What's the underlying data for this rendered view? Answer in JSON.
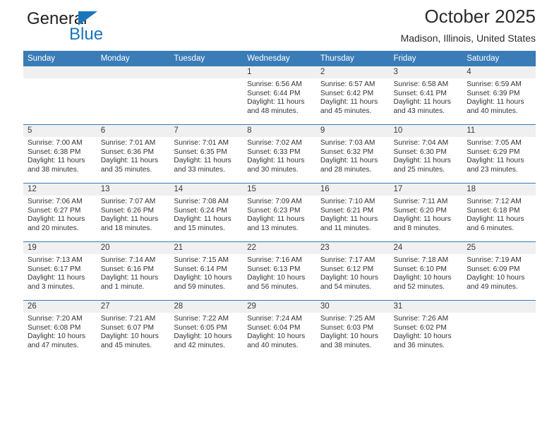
{
  "brand": {
    "name_top": "General",
    "name_bottom": "Blue",
    "logo_icon": "triangle-icon",
    "accent_color": "#1b75bb"
  },
  "header": {
    "title": "October 2025",
    "subtitle": "Madison, Illinois, United States"
  },
  "calendar": {
    "header_color": "#3a7cb8",
    "weekday_headers": [
      "Sunday",
      "Monday",
      "Tuesday",
      "Wednesday",
      "Thursday",
      "Friday",
      "Saturday"
    ],
    "weeks": [
      [
        {
          "day": "",
          "lines": []
        },
        {
          "day": "",
          "lines": []
        },
        {
          "day": "",
          "lines": []
        },
        {
          "day": "1",
          "lines": [
            "Sunrise: 6:56 AM",
            "Sunset: 6:44 PM",
            "Daylight: 11 hours",
            "and 48 minutes."
          ]
        },
        {
          "day": "2",
          "lines": [
            "Sunrise: 6:57 AM",
            "Sunset: 6:42 PM",
            "Daylight: 11 hours",
            "and 45 minutes."
          ]
        },
        {
          "day": "3",
          "lines": [
            "Sunrise: 6:58 AM",
            "Sunset: 6:41 PM",
            "Daylight: 11 hours",
            "and 43 minutes."
          ]
        },
        {
          "day": "4",
          "lines": [
            "Sunrise: 6:59 AM",
            "Sunset: 6:39 PM",
            "Daylight: 11 hours",
            "and 40 minutes."
          ]
        }
      ],
      [
        {
          "day": "5",
          "lines": [
            "Sunrise: 7:00 AM",
            "Sunset: 6:38 PM",
            "Daylight: 11 hours",
            "and 38 minutes."
          ]
        },
        {
          "day": "6",
          "lines": [
            "Sunrise: 7:01 AM",
            "Sunset: 6:36 PM",
            "Daylight: 11 hours",
            "and 35 minutes."
          ]
        },
        {
          "day": "7",
          "lines": [
            "Sunrise: 7:01 AM",
            "Sunset: 6:35 PM",
            "Daylight: 11 hours",
            "and 33 minutes."
          ]
        },
        {
          "day": "8",
          "lines": [
            "Sunrise: 7:02 AM",
            "Sunset: 6:33 PM",
            "Daylight: 11 hours",
            "and 30 minutes."
          ]
        },
        {
          "day": "9",
          "lines": [
            "Sunrise: 7:03 AM",
            "Sunset: 6:32 PM",
            "Daylight: 11 hours",
            "and 28 minutes."
          ]
        },
        {
          "day": "10",
          "lines": [
            "Sunrise: 7:04 AM",
            "Sunset: 6:30 PM",
            "Daylight: 11 hours",
            "and 25 minutes."
          ]
        },
        {
          "day": "11",
          "lines": [
            "Sunrise: 7:05 AM",
            "Sunset: 6:29 PM",
            "Daylight: 11 hours",
            "and 23 minutes."
          ]
        }
      ],
      [
        {
          "day": "12",
          "lines": [
            "Sunrise: 7:06 AM",
            "Sunset: 6:27 PM",
            "Daylight: 11 hours",
            "and 20 minutes."
          ]
        },
        {
          "day": "13",
          "lines": [
            "Sunrise: 7:07 AM",
            "Sunset: 6:26 PM",
            "Daylight: 11 hours",
            "and 18 minutes."
          ]
        },
        {
          "day": "14",
          "lines": [
            "Sunrise: 7:08 AM",
            "Sunset: 6:24 PM",
            "Daylight: 11 hours",
            "and 15 minutes."
          ]
        },
        {
          "day": "15",
          "lines": [
            "Sunrise: 7:09 AM",
            "Sunset: 6:23 PM",
            "Daylight: 11 hours",
            "and 13 minutes."
          ]
        },
        {
          "day": "16",
          "lines": [
            "Sunrise: 7:10 AM",
            "Sunset: 6:21 PM",
            "Daylight: 11 hours",
            "and 11 minutes."
          ]
        },
        {
          "day": "17",
          "lines": [
            "Sunrise: 7:11 AM",
            "Sunset: 6:20 PM",
            "Daylight: 11 hours",
            "and 8 minutes."
          ]
        },
        {
          "day": "18",
          "lines": [
            "Sunrise: 7:12 AM",
            "Sunset: 6:18 PM",
            "Daylight: 11 hours",
            "and 6 minutes."
          ]
        }
      ],
      [
        {
          "day": "19",
          "lines": [
            "Sunrise: 7:13 AM",
            "Sunset: 6:17 PM",
            "Daylight: 11 hours",
            "and 3 minutes."
          ]
        },
        {
          "day": "20",
          "lines": [
            "Sunrise: 7:14 AM",
            "Sunset: 6:16 PM",
            "Daylight: 11 hours",
            "and 1 minute."
          ]
        },
        {
          "day": "21",
          "lines": [
            "Sunrise: 7:15 AM",
            "Sunset: 6:14 PM",
            "Daylight: 10 hours",
            "and 59 minutes."
          ]
        },
        {
          "day": "22",
          "lines": [
            "Sunrise: 7:16 AM",
            "Sunset: 6:13 PM",
            "Daylight: 10 hours",
            "and 56 minutes."
          ]
        },
        {
          "day": "23",
          "lines": [
            "Sunrise: 7:17 AM",
            "Sunset: 6:12 PM",
            "Daylight: 10 hours",
            "and 54 minutes."
          ]
        },
        {
          "day": "24",
          "lines": [
            "Sunrise: 7:18 AM",
            "Sunset: 6:10 PM",
            "Daylight: 10 hours",
            "and 52 minutes."
          ]
        },
        {
          "day": "25",
          "lines": [
            "Sunrise: 7:19 AM",
            "Sunset: 6:09 PM",
            "Daylight: 10 hours",
            "and 49 minutes."
          ]
        }
      ],
      [
        {
          "day": "26",
          "lines": [
            "Sunrise: 7:20 AM",
            "Sunset: 6:08 PM",
            "Daylight: 10 hours",
            "and 47 minutes."
          ]
        },
        {
          "day": "27",
          "lines": [
            "Sunrise: 7:21 AM",
            "Sunset: 6:07 PM",
            "Daylight: 10 hours",
            "and 45 minutes."
          ]
        },
        {
          "day": "28",
          "lines": [
            "Sunrise: 7:22 AM",
            "Sunset: 6:05 PM",
            "Daylight: 10 hours",
            "and 42 minutes."
          ]
        },
        {
          "day": "29",
          "lines": [
            "Sunrise: 7:24 AM",
            "Sunset: 6:04 PM",
            "Daylight: 10 hours",
            "and 40 minutes."
          ]
        },
        {
          "day": "30",
          "lines": [
            "Sunrise: 7:25 AM",
            "Sunset: 6:03 PM",
            "Daylight: 10 hours",
            "and 38 minutes."
          ]
        },
        {
          "day": "31",
          "lines": [
            "Sunrise: 7:26 AM",
            "Sunset: 6:02 PM",
            "Daylight: 10 hours",
            "and 36 minutes."
          ]
        },
        {
          "day": "",
          "lines": []
        }
      ]
    ]
  }
}
